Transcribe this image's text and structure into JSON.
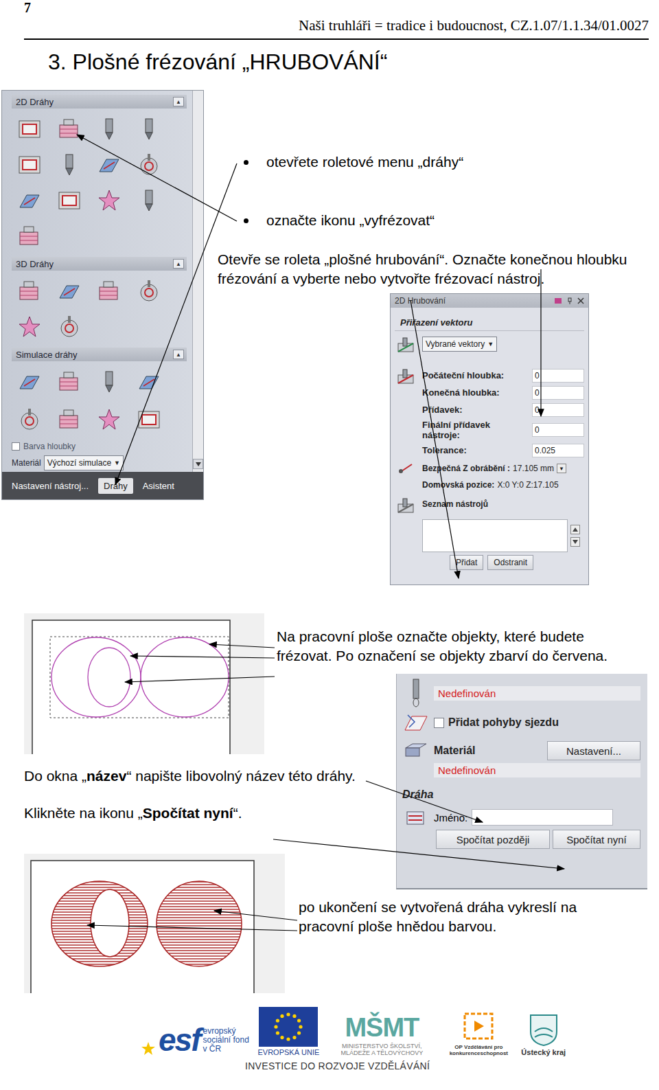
{
  "header": {
    "page_number": "7",
    "running_title": "Naši truhláři = tradice i budoucnost, CZ.1.07/1.1.34/01.0027"
  },
  "title": "3. Plošné frézování „HRUBOVÁNÍ“",
  "toolpath_panel": {
    "sections": [
      {
        "title": "2D Dráhy",
        "toggle": "▲"
      },
      {
        "title": "3D Dráhy",
        "toggle": "▲"
      },
      {
        "title": "Simulace dráhy",
        "toggle": "▲"
      }
    ],
    "depth_color": {
      "label": "Barva hloubky",
      "checked": false
    },
    "material": {
      "label": "Materiál",
      "value": "Výchozí simulace",
      "arrow": "▼"
    },
    "tabs": [
      {
        "label": "Nastavení nástroj...",
        "selected": false
      },
      {
        "label": "Dráhy",
        "selected": true
      },
      {
        "label": "Asistent",
        "selected": false
      }
    ]
  },
  "bullets": [
    "otevřete roletové menu „dráhy“",
    "označte ikonu „vyfrézovat“"
  ],
  "instruction": "Otevře se roleta „plošné hrubování“. Označte konečnou hloubku frézování a vyberte nebo vytvořte frézovací nástroj.",
  "roughing_panel": {
    "title": "2D Hrubování",
    "vector_title": "Přiřazení vektoru",
    "vector_dropdown": {
      "value": "Vybrané vektory",
      "arrow": "▼"
    },
    "fields": [
      {
        "label": "Počáteční hloubka:",
        "value": "0"
      },
      {
        "label": "Konečná hloubka:",
        "value": "0"
      },
      {
        "label": "Přídavek:",
        "value": "0"
      },
      {
        "label": "Finální přídavek nástroje:",
        "value": "0"
      },
      {
        "label": "Tolerance:",
        "value": "0.025"
      }
    ],
    "safe_z": {
      "label": "Bezpečná Z obrábění :",
      "value": "17.105 mm",
      "arrow": "▼"
    },
    "home": {
      "label": "Domovská pozice:",
      "value": "X:0 Y:0 Z:17.105"
    },
    "tool_list_title": "Seznam nástrojů",
    "tool_buttons": [
      "Přidat",
      "Odstranit"
    ]
  },
  "select_step": "Na pracovní ploše označte objekty, které budete frézovat. Po označení se objekty zbarví do červena.",
  "name_step": [
    {
      "text": "Do okna „",
      "bold": false
    },
    {
      "text": "název",
      "bold": true
    },
    {
      "text": "“ napište libovolný název této dráhy.",
      "bold": false
    }
  ],
  "calc_step": [
    {
      "text": "Klikněte na ikonu „",
      "bold": false
    },
    {
      "text": "Spočítat nyní",
      "bold": true
    },
    {
      "text": "“.",
      "bold": false
    }
  ],
  "calc_panel": {
    "tool_status": "Nedefinován",
    "ramp": {
      "label": "Přidat pohyby sjezdu",
      "checked": false
    },
    "material": {
      "label": "Materiál",
      "button": "Nastavení...",
      "status": "Nedefinován"
    },
    "toolpath_title": "Dráha",
    "name_label": "Jméno:",
    "name_value": "",
    "buttons": [
      "Spočítat později",
      "Spočítat nyní"
    ]
  },
  "result_step": "po ukončení se vytvořená dráha vykreslí na pracovní ploše hnědou barvou.",
  "footer": {
    "logos": [
      {
        "kind": "esf",
        "mark": "esf",
        "caption": "evropský sociální fond v ČR"
      },
      {
        "kind": "eu",
        "mark": "",
        "caption": "EVROPSKÁ UNIE"
      },
      {
        "kind": "msmt",
        "mark": "MŠMT",
        "caption": "MINISTERSTVO ŠKOLSTVÍ, MLÁDEŽE A TĚLOVÝCHOVY"
      },
      {
        "kind": "op",
        "mark": "",
        "caption": "OP Vzdělávání pro konkurenceschopnost"
      },
      {
        "kind": "kraj",
        "mark": "",
        "caption": "Ústecký kraj"
      }
    ],
    "tagline": "INVESTICE DO ROZVOJE VZDĚLÁVÁNÍ"
  }
}
